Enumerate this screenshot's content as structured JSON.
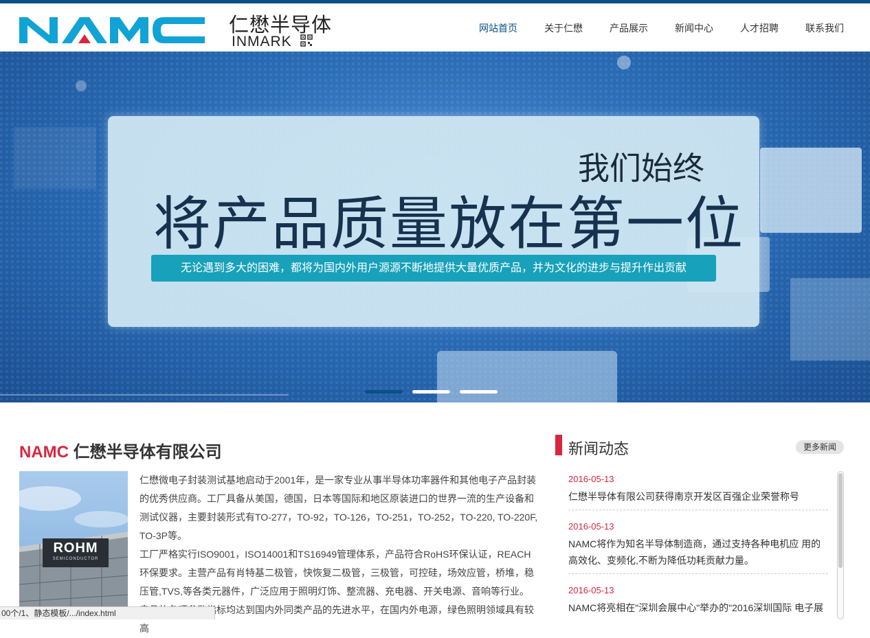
{
  "header": {
    "logo_text": "NAMC",
    "brand_cn": "仁懋半导体",
    "brand_en": "INMARK",
    "nav": [
      {
        "label": "网站首页",
        "active": true
      },
      {
        "label": "关于仁懋"
      },
      {
        "label": "产品展示"
      },
      {
        "label": "新闻中心"
      },
      {
        "label": "人才招聘"
      },
      {
        "label": "联系我们"
      }
    ]
  },
  "banner": {
    "subtitle": "我们始终",
    "headline": "将产品质量放在第一位",
    "strip": "无论遇到多大的困难，都将为国内外用户源源不断地提供大量优质产品，并为文化的进步与提升作出贡献",
    "slides": 3,
    "active_slide": 1
  },
  "company": {
    "title_accent": "NAMC",
    "title_rest": " 仁懋半导体有限公司",
    "image_label": "ROHM",
    "image_sub": "SEMICONDUCTOR",
    "paragraphs": [
      "仁懋微电子封装测试基地启动于2001年，是一家专业从事半导体功率器件和其他电子产品封装的优秀供应商。工厂具备从美国，德国，日本等国际和地区原装进口的世界一流的生产设备和测试仪器，主要封装形式有TO-277，TO-92，TO-126，TO-251，TO-252，TO-220, TO-220F, TO-3P等。",
      "工厂严格实行ISO9001，ISO14001和TS16949管理体系，产品符合RoHS环保认证，REACH环保要求。主营产品有肖特基二极管，快恢复二极管，三极管，可控硅，场效应管，桥堆，稳压管,TVS,等各类元器件，广泛应用于照明灯饰、整流器、充电器、开关电源、音响等行业。产品的各项参数指标均达到国内外同类产品的先进水平，在国内外电源，绿色照明领域具有较高"
    ]
  },
  "news": {
    "title": "新闻动态",
    "more": "更多新闻",
    "items": [
      {
        "date": "2016-05-13",
        "text": "仁懋半导体有限公司获得南京开发区百强企业荣誉称号"
      },
      {
        "date": "2016-05-13",
        "text": "NAMC将作为知名半导体制造商，通过支持各种电机应 用的高效化、变频化,不断为降低功耗贡献力量。"
      },
      {
        "date": "2016-05-13",
        "text": "NAMC将亮相在\"深圳会展中心\"举办的\"2016深圳国际 电子展"
      }
    ]
  },
  "statusbar": "00个/1、静态模板/.../index.html",
  "colors": {
    "primary": "#0a4f86",
    "accent": "#d8263f",
    "logo": "#12a3d6",
    "strip": "#17a1ba"
  }
}
